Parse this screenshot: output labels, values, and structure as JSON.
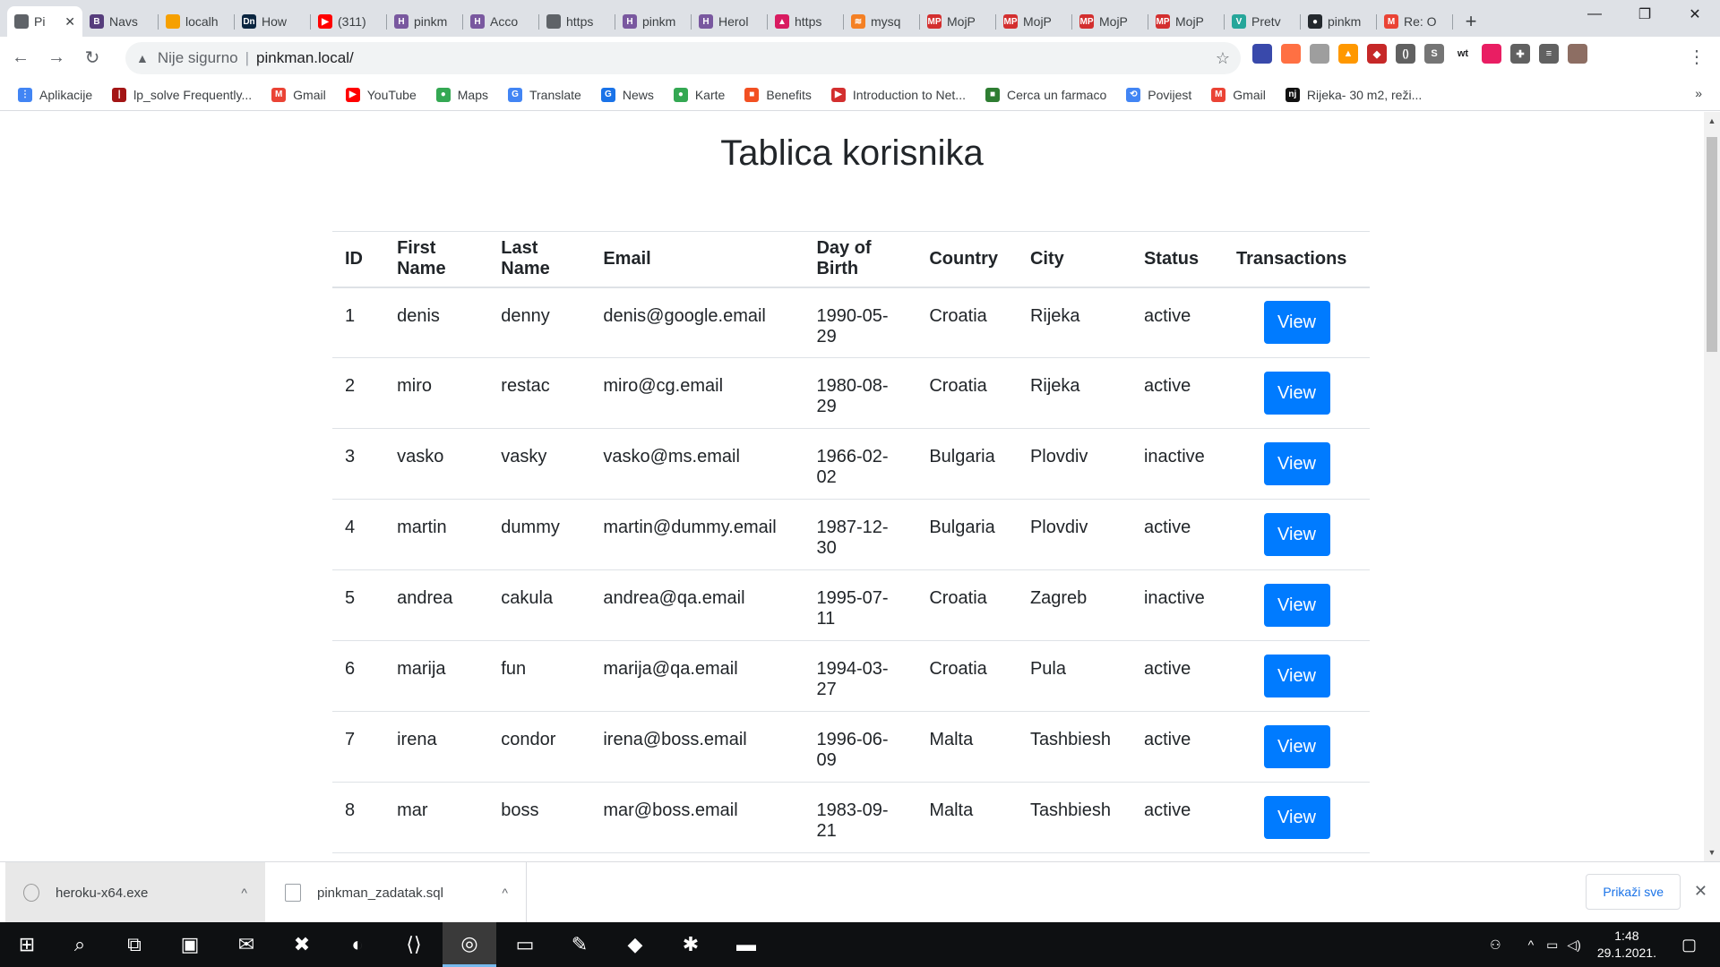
{
  "browser": {
    "tabs": [
      {
        "title": "Pi",
        "favicon_color": "#5f6368",
        "favicon_text": "",
        "active": true
      },
      {
        "title": "Navs",
        "favicon_color": "#563d7c",
        "favicon_text": "B"
      },
      {
        "title": "localh",
        "favicon_color": "#f6a000",
        "favicon_text": ""
      },
      {
        "title": "How",
        "favicon_color": "#0a2540",
        "favicon_text": "Dn"
      },
      {
        "title": "(311)",
        "favicon_color": "#ff0000",
        "favicon_text": "▶"
      },
      {
        "title": "pinkm",
        "favicon_color": "#79589f",
        "favicon_text": "H"
      },
      {
        "title": "Acco",
        "favicon_color": "#79589f",
        "favicon_text": "H"
      },
      {
        "title": "https",
        "favicon_color": "#5f6368",
        "favicon_text": ""
      },
      {
        "title": "pinkm",
        "favicon_color": "#79589f",
        "favicon_text": "H"
      },
      {
        "title": "Herol",
        "favicon_color": "#79589f",
        "favicon_text": "H"
      },
      {
        "title": "https",
        "favicon_color": "#d81b60",
        "favicon_text": "▲"
      },
      {
        "title": "mysq",
        "favicon_color": "#f48024",
        "favicon_text": "≋"
      },
      {
        "title": "MojP",
        "favicon_color": "#d32f2f",
        "favicon_text": "MP"
      },
      {
        "title": "MojP",
        "favicon_color": "#d32f2f",
        "favicon_text": "MP"
      },
      {
        "title": "MojP",
        "favicon_color": "#d32f2f",
        "favicon_text": "MP"
      },
      {
        "title": "MojP",
        "favicon_color": "#d32f2f",
        "favicon_text": "MP"
      },
      {
        "title": "Pretv",
        "favicon_color": "#26a69a",
        "favicon_text": "V"
      },
      {
        "title": "pinkm",
        "favicon_color": "#24292e",
        "favicon_text": "●"
      },
      {
        "title": "Re: O",
        "favicon_color": "#ea4335",
        "favicon_text": "M"
      }
    ],
    "active_tab_close": "✕",
    "new_tab": "+",
    "window_controls": {
      "minimize": "—",
      "maximize": "❐",
      "close": "✕"
    },
    "nav": {
      "back": "←",
      "forward": "→",
      "reload": "↻"
    },
    "address": {
      "security_icon": "▲",
      "security_label": "Nije sigurno",
      "separator": "|",
      "url": "pinkman.local/",
      "star": "☆"
    },
    "extensions": [
      {
        "name": "ext-1",
        "color": "#3949ab",
        "text": ""
      },
      {
        "name": "ext-2",
        "color": "#ff7043",
        "text": ""
      },
      {
        "name": "ext-3",
        "color": "#9e9e9e",
        "text": ""
      },
      {
        "name": "ext-4",
        "color": "#ff9800",
        "text": "▲"
      },
      {
        "name": "ext-5",
        "color": "#c62828",
        "text": "◆"
      },
      {
        "name": "ext-6",
        "color": "#616161",
        "text": "()"
      },
      {
        "name": "ext-7",
        "color": "#757575",
        "text": "S"
      },
      {
        "name": "ext-8",
        "color": "#ffffff",
        "text": "wt"
      },
      {
        "name": "ext-9",
        "color": "#e91e63",
        "text": ""
      },
      {
        "name": "ext-10",
        "color": "#616161",
        "text": "✚"
      },
      {
        "name": "ext-11",
        "color": "#616161",
        "text": "≡"
      },
      {
        "name": "ext-12",
        "color": "#8d6e63",
        "text": ""
      }
    ],
    "menu": "⋮",
    "bookmarks": [
      {
        "label": "Aplikacije",
        "color": "#4285f4",
        "text": "⋮"
      },
      {
        "label": "lp_solve Frequently...",
        "color": "#a31515",
        "text": "|"
      },
      {
        "label": "Gmail",
        "color": "#ea4335",
        "text": "M"
      },
      {
        "label": "YouTube",
        "color": "#ff0000",
        "text": "▶"
      },
      {
        "label": "Maps",
        "color": "#34a853",
        "text": "●"
      },
      {
        "label": "Translate",
        "color": "#4285f4",
        "text": "G"
      },
      {
        "label": "News",
        "color": "#1a73e8",
        "text": "G"
      },
      {
        "label": "Karte",
        "color": "#34a853",
        "text": "●"
      },
      {
        "label": "Benefits",
        "color": "#f25022",
        "text": "■"
      },
      {
        "label": "Introduction to Net...",
        "color": "#d32f2f",
        "text": "▶"
      },
      {
        "label": "Cerca un farmaco",
        "color": "#2e7d32",
        "text": "■"
      },
      {
        "label": "Povijest",
        "color": "#4285f4",
        "text": "⟲"
      },
      {
        "label": "Gmail",
        "color": "#ea4335",
        "text": "M"
      },
      {
        "label": "Rijeka- 30 m2, reži...",
        "color": "#111111",
        "text": "nj"
      }
    ],
    "bookmarks_more": "»"
  },
  "page": {
    "title": "Tablica korisnika",
    "table": {
      "headers": [
        "ID",
        "First Name",
        "Last Name",
        "Email",
        "Day of Birth",
        "Country",
        "City",
        "Status",
        "Transactions"
      ],
      "rows": [
        [
          "1",
          "denis",
          "denny",
          "denis@google.email",
          "1990-05-29",
          "Croatia",
          "Rijeka",
          "active"
        ],
        [
          "2",
          "miro",
          "restac",
          "miro@cg.email",
          "1980-08-29",
          "Croatia",
          "Rijeka",
          "active"
        ],
        [
          "3",
          "vasko",
          "vasky",
          "vasko@ms.email",
          "1966-02-02",
          "Bulgaria",
          "Plovdiv",
          "inactive"
        ],
        [
          "4",
          "martin",
          "dummy",
          "martin@dummy.email",
          "1987-12-30",
          "Bulgaria",
          "Plovdiv",
          "active"
        ],
        [
          "5",
          "andrea",
          "cakula",
          "andrea@qa.email",
          "1995-07-11",
          "Croatia",
          "Zagreb",
          "inactive"
        ],
        [
          "6",
          "marija",
          "fun",
          "marija@qa.email",
          "1994-03-27",
          "Croatia",
          "Pula",
          "active"
        ],
        [
          "7",
          "irena",
          "condor",
          "irena@boss.email",
          "1996-06-09",
          "Malta",
          "Tashbiesh",
          "active"
        ],
        [
          "8",
          "mar",
          "boss",
          "mar@boss.email",
          "1983-09-21",
          "Malta",
          "Tashbiesh",
          "active"
        ]
      ],
      "action_label": "View"
    }
  },
  "scrollbar": {
    "up": "▲",
    "down": "▼"
  },
  "downloads": {
    "items": [
      {
        "filename": "heroku-x64.exe",
        "chevron": "^"
      },
      {
        "filename": "pinkman_zadatak.sql",
        "chevron": "^"
      }
    ],
    "show_all": "Prikaži sve",
    "close": "✕"
  },
  "taskbar": {
    "apps": [
      {
        "name": "start",
        "glyph": "⊞"
      },
      {
        "name": "search",
        "glyph": "⌕"
      },
      {
        "name": "task-view",
        "glyph": "⧉"
      },
      {
        "name": "store",
        "glyph": "▣"
      },
      {
        "name": "mail",
        "glyph": "✉"
      },
      {
        "name": "xampp",
        "glyph": "✖"
      },
      {
        "name": "edge",
        "glyph": "◐"
      },
      {
        "name": "vscode",
        "glyph": "⟨⟩"
      },
      {
        "name": "chrome",
        "glyph": "◎"
      },
      {
        "name": "explorer",
        "glyph": "▭"
      },
      {
        "name": "paint",
        "glyph": "✎"
      },
      {
        "name": "app-crystal",
        "glyph": "◆"
      },
      {
        "name": "app-spider",
        "glyph": "✱"
      },
      {
        "name": "terminal",
        "glyph": "▬"
      }
    ],
    "tray": {
      "people": "⚇",
      "caret": "^",
      "battery": "▭",
      "volume": "◁)",
      "time": "1:48",
      "date": "29.1.2021.",
      "notifications": "▢"
    }
  }
}
